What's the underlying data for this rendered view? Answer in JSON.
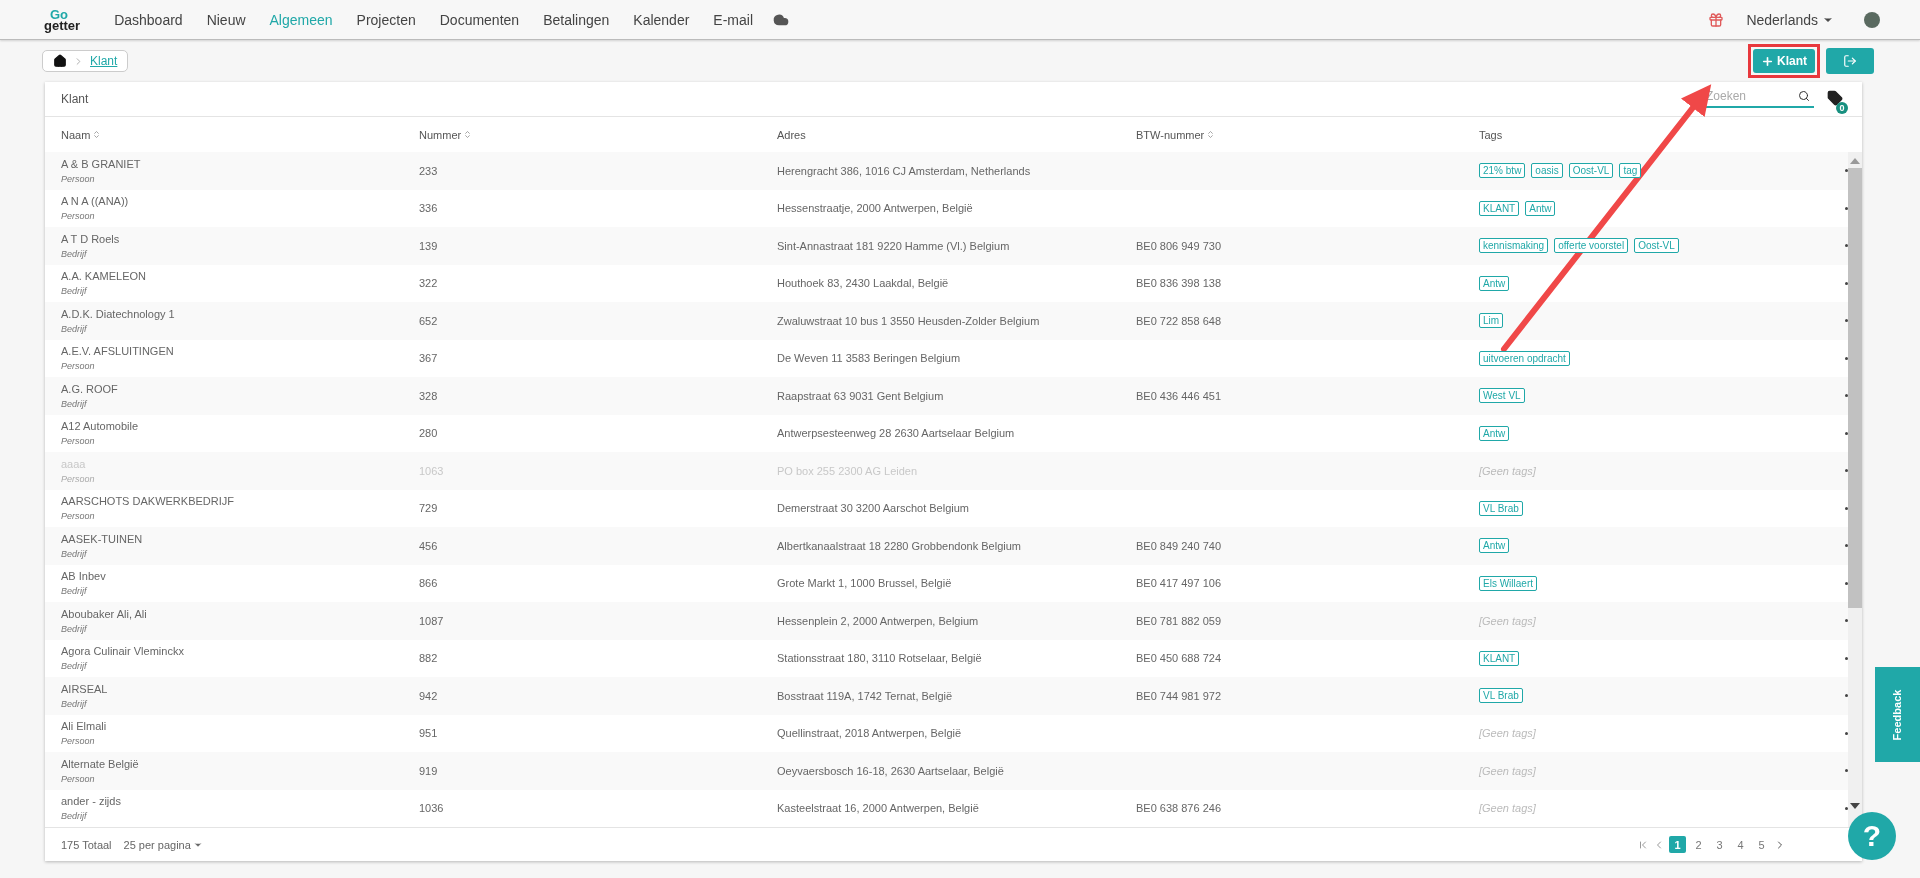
{
  "nav": {
    "logo_top": "Go",
    "logo_bottom": "getter",
    "items": [
      {
        "label": "Dashboard",
        "selected": false
      },
      {
        "label": "Nieuw",
        "selected": false
      },
      {
        "label": "Algemeen",
        "selected": true
      },
      {
        "label": "Projecten",
        "selected": false
      },
      {
        "label": "Documenten",
        "selected": false
      },
      {
        "label": "Betalingen",
        "selected": false
      },
      {
        "label": "Kalender",
        "selected": false
      },
      {
        "label": "E-mail",
        "selected": false
      }
    ],
    "language": "Nederlands"
  },
  "breadcrumb": {
    "current": "Klant"
  },
  "actions": {
    "add_label": "Klant",
    "highlighted": true
  },
  "card": {
    "title": "Klant",
    "search_placeholder": "Zoeken",
    "tag_filter_count": "0"
  },
  "table": {
    "columns": [
      {
        "label": "Naam",
        "sortable": true
      },
      {
        "label": "Nummer",
        "sortable": true
      },
      {
        "label": "Adres",
        "sortable": false
      },
      {
        "label": "BTW-nummer",
        "sortable": true
      },
      {
        "label": "Tags",
        "sortable": false
      }
    ],
    "rows": [
      {
        "name": "A & B GRANIET",
        "type": "Persoon",
        "number": "233",
        "address": "Herengracht 386, 1016 CJ Amsterdam, Netherlands",
        "vat": "",
        "tags": [
          "21% btw",
          "oasis",
          "Oost-VL",
          "tag"
        ],
        "disabled": false
      },
      {
        "name": "A N A ((ANA))",
        "type": "Persoon",
        "number": "336",
        "address": "Hessenstraatje, 2000 Antwerpen, België",
        "vat": "",
        "tags": [
          "KLANT",
          "Antw"
        ],
        "disabled": false
      },
      {
        "name": "A T D Roels",
        "type": "Bedrijf",
        "number": "139",
        "address": "Sint-Annastraat 181 9220 Hamme (Vl.) Belgium",
        "vat": "BE0 806 949 730",
        "tags": [
          "kennismaking",
          "offerte voorstel",
          "Oost-VL"
        ],
        "disabled": false
      },
      {
        "name": "A.A. KAMELEON",
        "type": "Bedrijf",
        "number": "322",
        "address": "Houthoek 83, 2430 Laakdal, België",
        "vat": "BE0 836 398 138",
        "tags": [
          "Antw"
        ],
        "disabled": false
      },
      {
        "name": "A.D.K. Diatechnology 1",
        "type": "Bedrijf",
        "number": "652",
        "address": "Zwaluwstraat 10 bus 1 3550 Heusden-Zolder Belgium",
        "vat": "BE0 722 858 648",
        "tags": [
          "Lim"
        ],
        "disabled": false
      },
      {
        "name": "A.E.V. AFSLUITINGEN",
        "type": "Persoon",
        "number": "367",
        "address": "De Weven 11 3583 Beringen Belgium",
        "vat": "",
        "tags": [
          "uitvoeren opdracht"
        ],
        "disabled": false
      },
      {
        "name": "A.G. ROOF",
        "type": "Bedrijf",
        "number": "328",
        "address": "Raapstraat 63 9031 Gent Belgium",
        "vat": "BE0 436 446 451",
        "tags": [
          "West VL"
        ],
        "disabled": false
      },
      {
        "name": "A12 Automobile",
        "type": "Persoon",
        "number": "280",
        "address": "Antwerpsesteenweg 28 2630 Aartselaar Belgium",
        "vat": "",
        "tags": [
          "Antw"
        ],
        "disabled": false
      },
      {
        "name": "aaaa",
        "type": "Persoon",
        "number": "1063",
        "address": "PO box 255 2300 AG Leiden",
        "vat": "",
        "tags": [],
        "no_tags": "[Geen tags]",
        "disabled": true
      },
      {
        "name": "AARSCHOTS DAKWERKBEDRIJF",
        "type": "Persoon",
        "number": "729",
        "address": "Demerstraat 30 3200 Aarschot Belgium",
        "vat": "",
        "tags": [
          "VL Brab"
        ],
        "disabled": false
      },
      {
        "name": "AASEK-TUINEN",
        "type": "Bedrijf",
        "number": "456",
        "address": "Albertkanaalstraat 18 2280 Grobbendonk Belgium",
        "vat": "BE0 849 240 740",
        "tags": [
          "Antw"
        ],
        "disabled": false
      },
      {
        "name": "AB Inbev",
        "type": "Bedrijf",
        "number": "866",
        "address": "Grote Markt 1, 1000 Brussel, België",
        "vat": "BE0 417 497 106",
        "tags": [
          "Els Willaert"
        ],
        "disabled": false
      },
      {
        "name": "Aboubaker Ali, Ali",
        "type": "Bedrijf",
        "number": "1087",
        "address": "Hessenplein 2, 2000 Antwerpen, Belgium",
        "vat": "BE0 781 882 059",
        "tags": [],
        "no_tags": "[Geen tags]",
        "disabled": false
      },
      {
        "name": "Agora Culinair Vleminckx",
        "type": "Bedrijf",
        "number": "882",
        "address": "Stationsstraat 180, 3110 Rotselaar, België",
        "vat": "BE0 450 688 724",
        "tags": [
          "KLANT"
        ],
        "disabled": false
      },
      {
        "name": "AIRSEAL",
        "type": "Bedrijf",
        "number": "942",
        "address": "Bosstraat 119A, 1742 Ternat, België",
        "vat": "BE0 744 981 972",
        "tags": [
          "VL Brab"
        ],
        "disabled": false
      },
      {
        "name": "Ali Elmali",
        "type": "Persoon",
        "number": "951",
        "address": "Quellinstraat, 2018 Antwerpen, België",
        "vat": "",
        "tags": [],
        "no_tags": "[Geen tags]",
        "disabled": false
      },
      {
        "name": "Alternate België",
        "type": "Persoon",
        "number": "919",
        "address": "Oeyvaersbosch 16-18, 2630 Aartselaar, België",
        "vat": "",
        "tags": [],
        "no_tags": "[Geen tags]",
        "disabled": false
      },
      {
        "name": "ander - zijds",
        "type": "Bedrijf",
        "number": "1036",
        "address": "Kasteelstraat 16, 2000 Antwerpen, België",
        "vat": "BE0 638 876 246",
        "tags": [],
        "no_tags": "[Geen tags]",
        "disabled": false
      }
    ]
  },
  "footer": {
    "total": "175 Totaal",
    "page_size": "25 per pagina",
    "pages": [
      {
        "label": "1",
        "selected": true
      },
      {
        "label": "2",
        "selected": false
      },
      {
        "label": "3",
        "selected": false
      },
      {
        "label": "4",
        "selected": false
      },
      {
        "label": "5",
        "selected": false
      }
    ]
  },
  "feedback": "Feedback",
  "help": "?"
}
